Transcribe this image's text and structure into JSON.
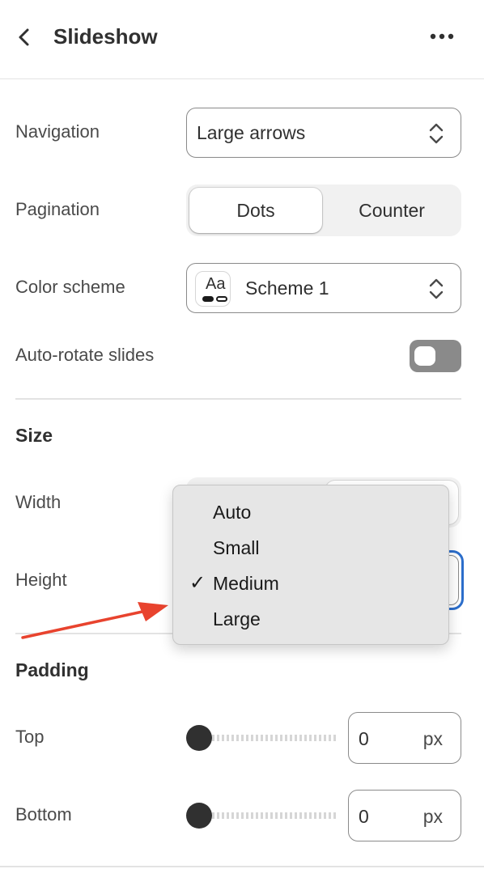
{
  "header": {
    "title": "Slideshow",
    "back_icon": "chevron-left-icon",
    "more_icon": "ellipsis-icon"
  },
  "navigation": {
    "label": "Navigation",
    "value": "Large arrows"
  },
  "pagination": {
    "label": "Pagination",
    "options": [
      "Dots",
      "Counter"
    ],
    "selected": "Dots"
  },
  "color_scheme": {
    "label": "Color scheme",
    "swatch_text": "Aa",
    "value": "Scheme 1"
  },
  "auto_rotate": {
    "label": "Auto-rotate slides",
    "enabled": false
  },
  "size": {
    "title": "Size",
    "width_label": "Width",
    "height_label": "Height"
  },
  "height_dropdown": {
    "options": [
      "Auto",
      "Small",
      "Medium",
      "Large"
    ],
    "selected": "Medium",
    "check_mark": "✓"
  },
  "padding": {
    "title": "Padding",
    "top": {
      "label": "Top",
      "value": "0",
      "unit": "px"
    },
    "bottom": {
      "label": "Bottom",
      "value": "0",
      "unit": "px"
    }
  },
  "colors": {
    "accent_focus": "#2c6ecb",
    "annotation_arrow": "#e8432e"
  }
}
